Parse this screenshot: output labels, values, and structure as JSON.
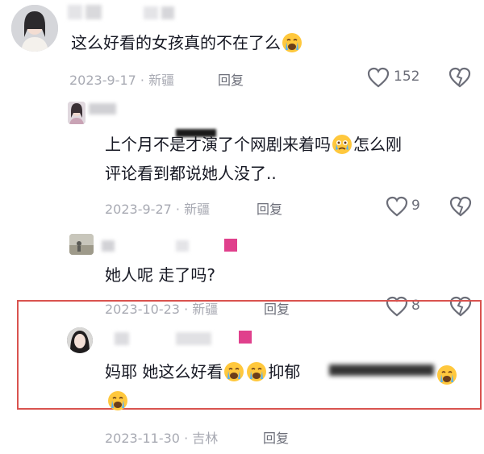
{
  "comments": [
    {
      "text": "这么好看的女孩真的不在了么",
      "date": "2023-9-17",
      "separator": "·",
      "location": "新疆",
      "reply_label": "回复",
      "like_count": "152"
    },
    {
      "text_line1": "上个月不是才演了个网剧来着吗",
      "text_line1_tail": "怎么刚",
      "text_line2": "评论看到都说她人没了..",
      "date": "2023-9-27",
      "separator": "·",
      "location": "新疆",
      "reply_label": "回复",
      "like_count": "9"
    },
    {
      "text": "她人呢 走了吗?",
      "date": "2023-10-23",
      "separator": "·",
      "location": "新疆",
      "reply_label": "回复",
      "like_count": "8"
    },
    {
      "text_start": "妈耶 她这么好看",
      "text_mid": "抑郁",
      "date": "2023-11-30",
      "separator": "·",
      "location": "吉林",
      "reply_label": "回复"
    }
  ],
  "icons": {
    "like": "heart-outline-icon",
    "dislike": "broken-heart-icon",
    "emoji": "crying-face-emoji"
  },
  "colors": {
    "highlight_border": "#d9534f",
    "meta_text": "#a8aab3",
    "redaction_pink": "#e0408c"
  }
}
